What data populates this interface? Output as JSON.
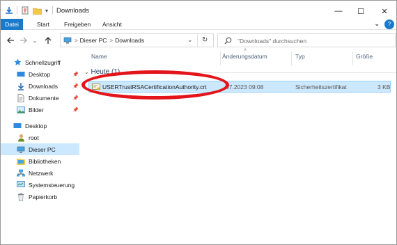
{
  "window": {
    "title": "Downloads",
    "buttons": {
      "minimize": "—",
      "maximize": "☐",
      "close": "✕"
    }
  },
  "quick_access_toolbar": {
    "icons": [
      "save-icon",
      "properties-icon",
      "new-folder-icon",
      "customize-dropdown-icon"
    ]
  },
  "ribbon": {
    "tabs": [
      {
        "label": "Datei",
        "active": true
      },
      {
        "label": "Start"
      },
      {
        "label": "Freigeben"
      },
      {
        "label": "Ansicht"
      }
    ],
    "expand": "⌄",
    "help": "?"
  },
  "address_bar": {
    "breadcrumb": [
      "Dieser PC",
      "Downloads"
    ],
    "separator": ">",
    "dropdown": "⌄",
    "refresh": "↻"
  },
  "search": {
    "placeholder": "\"Downloads\" durchsuchen"
  },
  "navigation": {
    "items": [
      {
        "label": "Schnellzugriff",
        "icon": "star-icon"
      },
      {
        "label": "Desktop",
        "icon": "desktop-icon",
        "pinned": true
      },
      {
        "label": "Downloads",
        "icon": "download-icon",
        "pinned": true
      },
      {
        "label": "Dokumente",
        "icon": "document-icon",
        "pinned": true
      },
      {
        "label": "Bilder",
        "icon": "pictures-icon",
        "pinned": true
      },
      {
        "label": "Desktop",
        "icon": "desktop-icon"
      },
      {
        "label": "root",
        "icon": "user-icon"
      },
      {
        "label": "Dieser PC",
        "icon": "computer-icon",
        "selected": true
      },
      {
        "label": "Bibliotheken",
        "icon": "library-icon"
      },
      {
        "label": "Netzwerk",
        "icon": "network-icon"
      },
      {
        "label": "Systemsteuerung",
        "icon": "control-panel-icon"
      },
      {
        "label": "Papierkorb",
        "icon": "recycle-bin-icon"
      }
    ]
  },
  "columns": {
    "name": "Name",
    "date": "Änderungsdatum",
    "type": "Typ",
    "size": "Größe"
  },
  "groups": [
    {
      "label": "Heute (1)",
      "files": [
        {
          "name": "USERTrustRSACertificationAuthority.crt",
          "date": "07.2023 09:08",
          "type": "Sicherheitszertifikat",
          "size": "3 KB",
          "selected": true
        }
      ]
    }
  ],
  "colors": {
    "accent": "#1979ca",
    "selection": "#cce8ff",
    "annotation": "#e3141a"
  }
}
